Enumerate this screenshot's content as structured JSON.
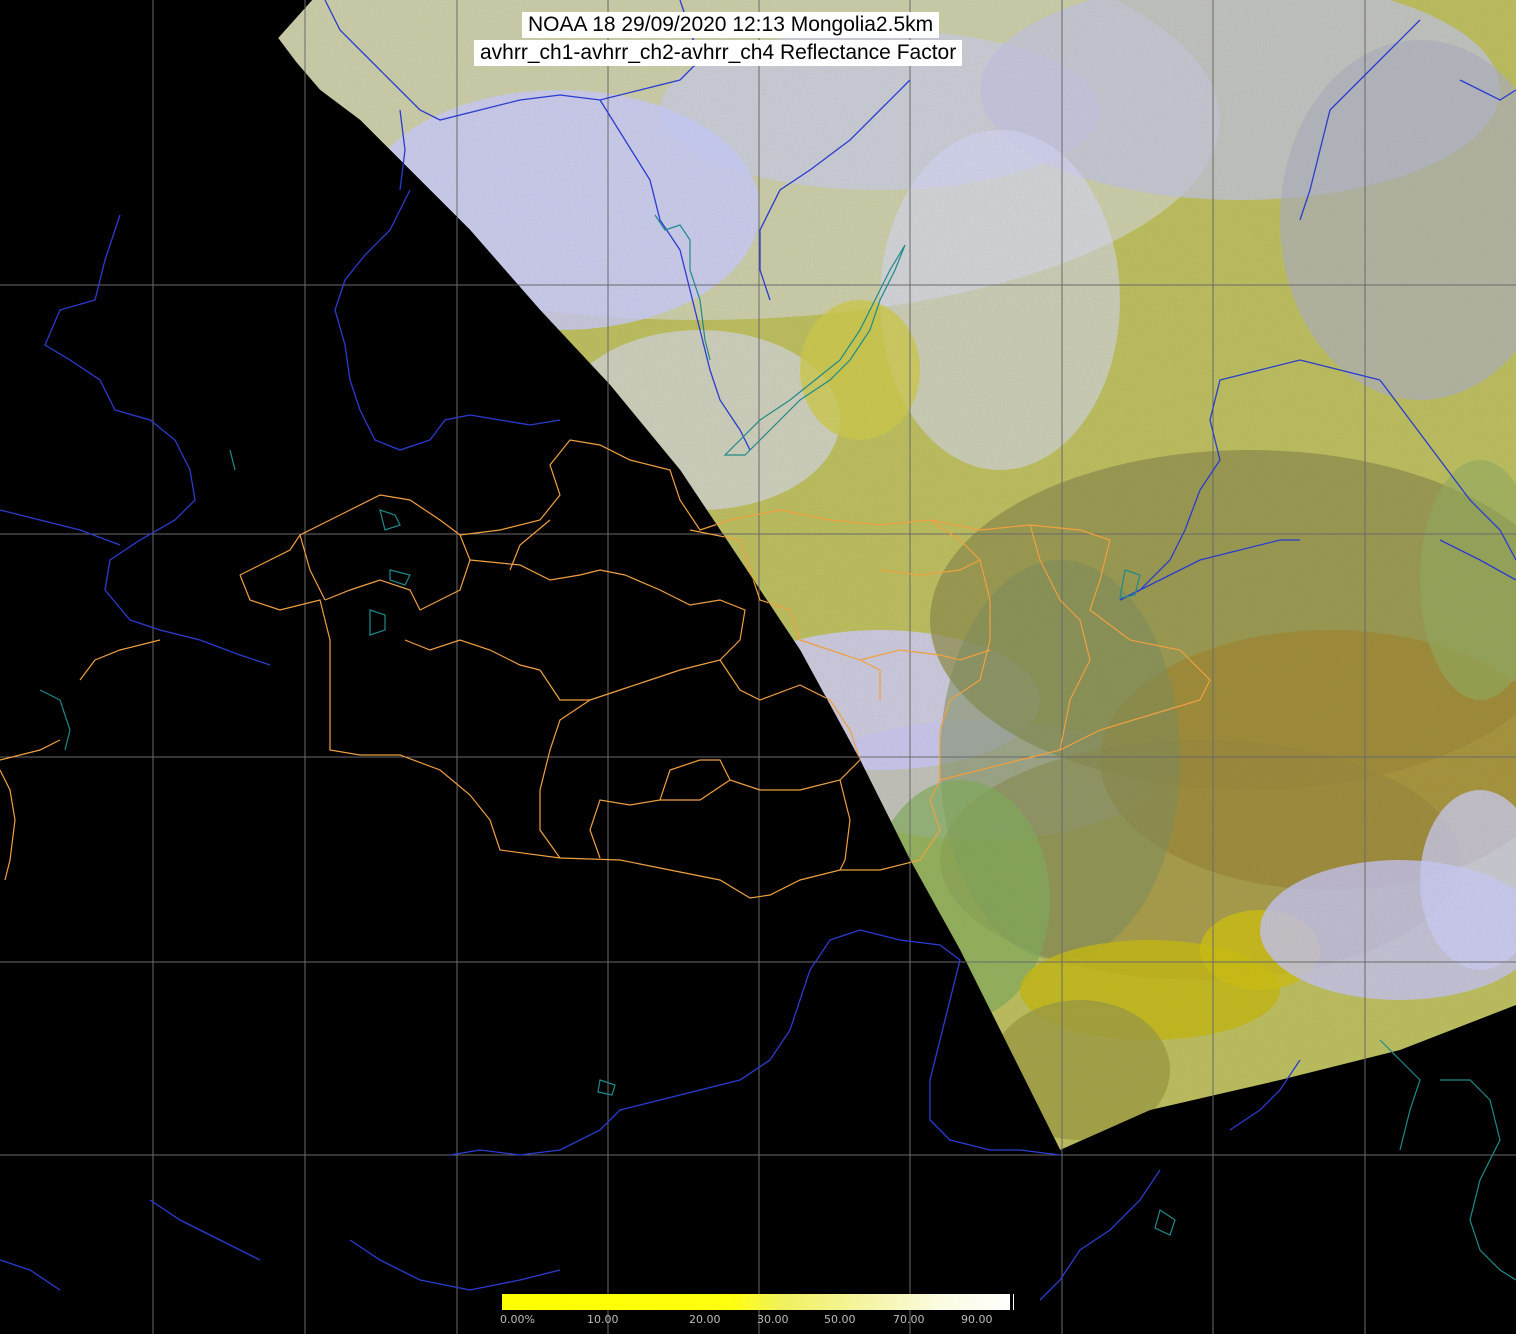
{
  "header": {
    "title_line1": "NOAA 18 29/09/2020 12:13 Mongolia2.5km",
    "title_line2": "avhrr_ch1-avhrr_ch2-avhrr_ch4 Reflectance Factor"
  },
  "legend": {
    "tick_labels": [
      "0.00%",
      "10.00",
      "20.00",
      "30.00",
      "50.00",
      "70.00",
      "90.00"
    ],
    "colors": [
      "#ffff00",
      "#ffff20",
      "#ffff40",
      "#f0f070",
      "#f5f5a0",
      "#fafad0",
      "#ffffff"
    ]
  },
  "map": {
    "background_color": "#000000",
    "grid_color": "#6a6a6a",
    "river_color": "#2a3cd0",
    "lake_color": "#1f8a8a",
    "admin_border_color": "#f0a040",
    "swath_colors": {
      "cloud": "#b9bdf0",
      "vegetation": "#b8ba50",
      "bare_ground": "#8a8a40",
      "haze": "#c6c8a8",
      "green": "#7fa860"
    },
    "icons": [
      "admin-border",
      "river",
      "lake",
      "graticule"
    ]
  }
}
